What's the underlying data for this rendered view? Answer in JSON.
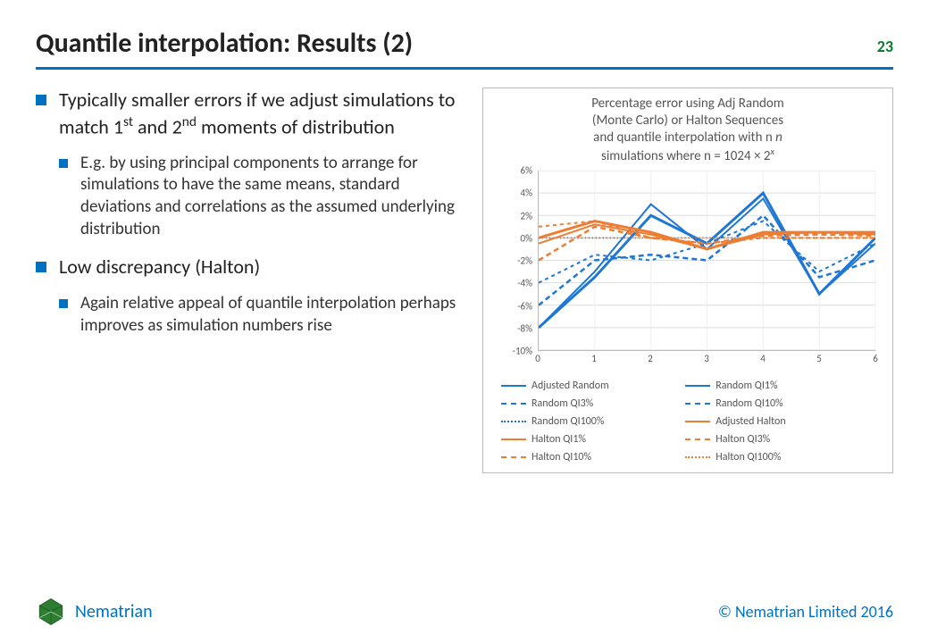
{
  "header": {
    "title": "Quantile interpolation: Results (2)",
    "page": "23"
  },
  "bullets": {
    "b1_pre": "Typically smaller errors if we adjust simulations to match 1",
    "b1_sup1": "st",
    "b1_mid": " and 2",
    "b1_sup2": "nd",
    "b1_post": " moments of distribution",
    "b1a": "E.g. by using principal components to arrange for simulations to have the same means, standard deviations and correlations as the assumed underlying distribution",
    "b2": "Low discrepancy (Halton)",
    "b2a": "Again relative appeal of quantile interpolation perhaps improves as simulation numbers rise"
  },
  "chart_data": {
    "type": "line",
    "title_l1": "Percentage error using Adj Random",
    "title_l2": "(Monte Carlo) or Halton Sequences",
    "title_l3": "and quantile interpolation with n",
    "title_l4": "simulations where n = 1024 × 2",
    "title_sup": "x",
    "x": [
      0,
      1,
      2,
      3,
      4,
      5,
      6
    ],
    "x_ticklabels": [
      "0",
      "1",
      "2",
      "3",
      "4",
      "5",
      "6"
    ],
    "ylim": [
      -10,
      6
    ],
    "y_ticks": [
      -10,
      -8,
      -6,
      -4,
      -2,
      0,
      2,
      4,
      6
    ],
    "y_ticklabels": [
      "-10%",
      "-8%",
      "-6%",
      "-4%",
      "-2%",
      "0%",
      "2%",
      "4%",
      "6%"
    ],
    "colors": {
      "blue": "#1f77d4",
      "orange": "#ed7d31"
    },
    "series": [
      {
        "name": "Adjusted Random",
        "color": "blue",
        "dash": "solid",
        "width": 3,
        "values": [
          -8.0,
          -3.5,
          2.0,
          -0.5,
          4.0,
          -5.0,
          0.0
        ]
      },
      {
        "name": "Random QI1%",
        "color": "blue",
        "dash": "solid",
        "width": 2,
        "values": [
          -8.0,
          -3.0,
          3.0,
          -1.0,
          3.5,
          -5.0,
          -0.5
        ]
      },
      {
        "name": "Random QI3%",
        "color": "blue",
        "dash": "6,4",
        "width": 2.5,
        "values": [
          -6.0,
          -2.0,
          -1.5,
          -2.0,
          2.0,
          -3.5,
          -2.0
        ]
      },
      {
        "name": "Random QI10%",
        "color": "blue",
        "dash": "4,4",
        "width": 2,
        "values": [
          -4.0,
          -1.5,
          -2.0,
          -0.5,
          1.5,
          -3.0,
          -0.5
        ]
      },
      {
        "name": "Random QI100%",
        "color": "blue",
        "dash": "1,3",
        "width": 2,
        "values": [
          0.0,
          0.0,
          0.0,
          0.0,
          0.0,
          0.0,
          0.0
        ]
      },
      {
        "name": "Adjusted Halton",
        "color": "orange",
        "dash": "solid",
        "width": 3,
        "values": [
          0.0,
          1.5,
          0.5,
          -1.0,
          0.5,
          0.5,
          0.5
        ]
      },
      {
        "name": "Halton QI1%",
        "color": "orange",
        "dash": "solid",
        "width": 2,
        "values": [
          -0.5,
          1.2,
          0.3,
          -1.0,
          0.3,
          0.5,
          0.3
        ]
      },
      {
        "name": "Halton QI3%",
        "color": "orange",
        "dash": "6,4",
        "width": 2.5,
        "values": [
          -2.0,
          1.0,
          0.0,
          -0.5,
          0.2,
          0.3,
          0.2
        ]
      },
      {
        "name": "Halton QI10%",
        "color": "orange",
        "dash": "4,4",
        "width": 2,
        "values": [
          1.0,
          1.5,
          0.0,
          -0.5,
          0.0,
          0.0,
          0.0
        ]
      },
      {
        "name": "Halton QI100%",
        "color": "orange",
        "dash": "1,3",
        "width": 2,
        "values": [
          0.0,
          0.0,
          0.0,
          0.0,
          0.0,
          0.0,
          0.0
        ]
      }
    ]
  },
  "footer": {
    "brand": "Nematrian",
    "copyright": "© Nematrian Limited 2016"
  }
}
